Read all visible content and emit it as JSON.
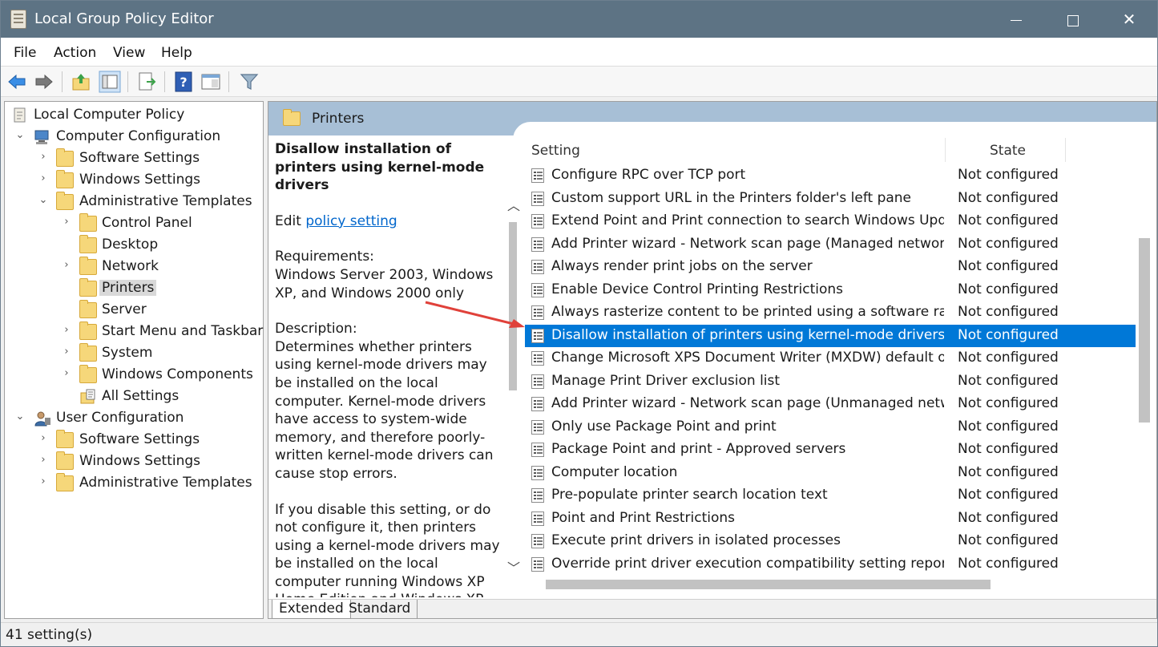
{
  "window": {
    "title": "Local Group Policy Editor"
  },
  "menu": [
    "File",
    "Action",
    "View",
    "Help"
  ],
  "tree": [
    {
      "label": "Local Computer Policy",
      "icon": "policy-doc-icon",
      "expander": ""
    },
    {
      "label": "Computer Configuration",
      "icon": "computer-icon",
      "expander": "expanded"
    },
    {
      "label": "Software Settings",
      "icon": "folder-icon",
      "expander": "collapsed"
    },
    {
      "label": "Windows Settings",
      "icon": "folder-icon",
      "expander": "collapsed"
    },
    {
      "label": "Administrative Templates",
      "icon": "folder-icon",
      "expander": "expanded"
    },
    {
      "label": "Control Panel",
      "icon": "folder-icon",
      "expander": "collapsed"
    },
    {
      "label": "Desktop",
      "icon": "folder-icon",
      "expander": ""
    },
    {
      "label": "Network",
      "icon": "folder-icon",
      "expander": "collapsed"
    },
    {
      "label": "Printers",
      "icon": "folder-icon",
      "expander": "",
      "selected": true
    },
    {
      "label": "Server",
      "icon": "folder-icon",
      "expander": ""
    },
    {
      "label": "Start Menu and Taskbar",
      "icon": "folder-icon",
      "expander": "collapsed"
    },
    {
      "label": "System",
      "icon": "folder-icon",
      "expander": "collapsed"
    },
    {
      "label": "Windows Components",
      "icon": "folder-icon",
      "expander": "collapsed"
    },
    {
      "label": "All Settings",
      "icon": "all-settings-icon",
      "expander": ""
    },
    {
      "label": "User Configuration",
      "icon": "user-icon",
      "expander": "expanded"
    },
    {
      "label": "Software Settings",
      "icon": "folder-icon",
      "expander": "collapsed"
    },
    {
      "label": "Windows Settings",
      "icon": "folder-icon",
      "expander": "collapsed"
    },
    {
      "label": "Administrative Templates",
      "icon": "folder-icon",
      "expander": "collapsed"
    }
  ],
  "header": {
    "title": "Printers"
  },
  "description": {
    "title": "Disallow installation of printers using kernel-mode drivers",
    "edit_prefix": "Edit ",
    "edit_link": "policy setting ",
    "requirements_label": "Requirements:",
    "requirements": "Windows Server 2003, Windows XP, and Windows 2000 only",
    "description_label": "Description:",
    "description": "Determines whether printers using kernel-mode drivers may be installed on the local computer. Kernel-mode drivers have access to system-wide memory, and therefore poorly-written kernel-mode drivers can cause stop errors.",
    "disable_text": "If you disable this setting, or do not configure it, then printers using a kernel-mode drivers may be installed on the local computer running Windows XP Home Edition and Windows XP"
  },
  "columns": {
    "setting": "Setting",
    "state": "State"
  },
  "settings": [
    {
      "setting": "Configure RPC over TCP port",
      "state": "Not configured"
    },
    {
      "setting": "Custom support URL in the Printers folder's left pane",
      "state": "Not configured"
    },
    {
      "setting": "Extend Point and Print connection to search Windows Update",
      "state": "Not configured"
    },
    {
      "setting": "Add Printer wizard - Network scan page (Managed network)",
      "state": "Not configured"
    },
    {
      "setting": "Always render print jobs on the server",
      "state": "Not configured"
    },
    {
      "setting": "Enable Device Control Printing Restrictions",
      "state": "Not configured"
    },
    {
      "setting": "Always rasterize content to be printed using a software rasteri...",
      "state": "Not configured"
    },
    {
      "setting": "Disallow installation of printers using kernel-mode drivers",
      "state": "Not configured",
      "selected": true
    },
    {
      "setting": "Change Microsoft XPS Document Writer (MXDW) default out...",
      "state": "Not configured"
    },
    {
      "setting": "Manage Print Driver exclusion list",
      "state": "Not configured"
    },
    {
      "setting": "Add Printer wizard - Network scan page (Unmanaged network)",
      "state": "Not configured"
    },
    {
      "setting": "Only use Package Point and print",
      "state": "Not configured"
    },
    {
      "setting": "Package Point and print - Approved servers",
      "state": "Not configured"
    },
    {
      "setting": "Computer location",
      "state": "Not configured"
    },
    {
      "setting": "Pre-populate printer search location text",
      "state": "Not configured"
    },
    {
      "setting": "Point and Print Restrictions",
      "state": "Not configured"
    },
    {
      "setting": "Execute print drivers in isolated processes",
      "state": "Not configured"
    },
    {
      "setting": "Override print driver execution compatibility setting reported...",
      "state": "Not configured"
    }
  ],
  "tabs": [
    "Extended",
    "Standard"
  ],
  "status": "41 setting(s)",
  "colors": {
    "titlebar": "#5d7384",
    "selection": "#0078d7",
    "header": "#a7bfd6",
    "annotation_arrow": "#e0413a"
  }
}
